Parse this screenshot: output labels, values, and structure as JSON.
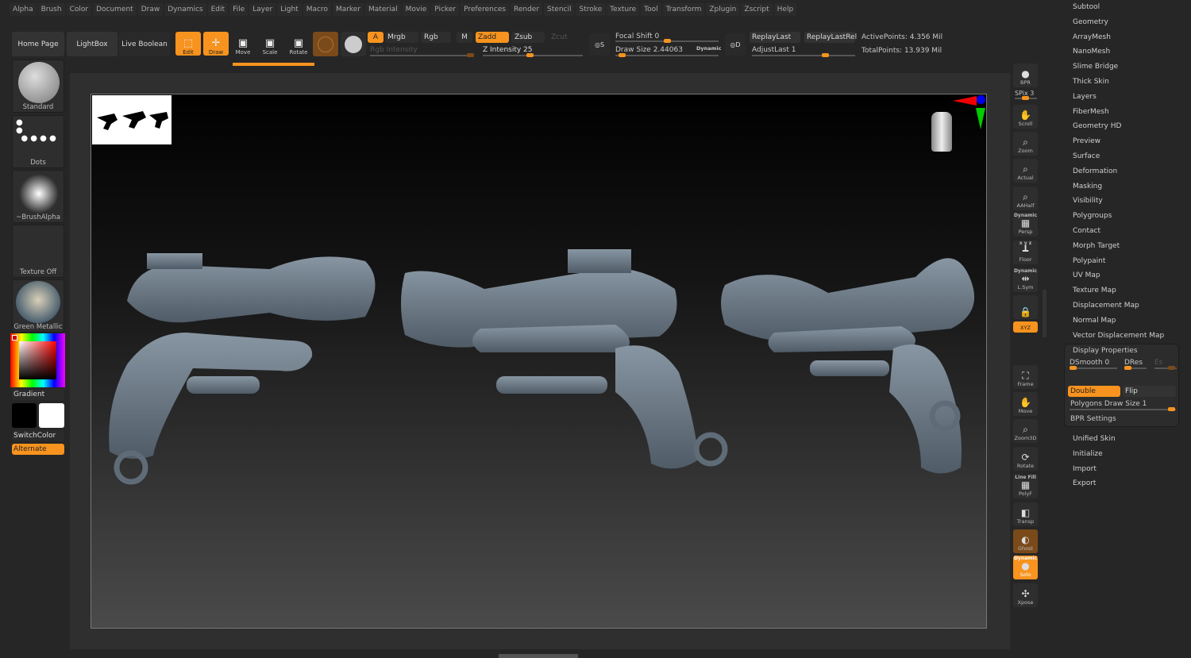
{
  "menu": [
    "Alpha",
    "Brush",
    "Color",
    "Document",
    "Draw",
    "Dynamics",
    "Edit",
    "File",
    "Layer",
    "Light",
    "Macro",
    "Marker",
    "Material",
    "Movie",
    "Picker",
    "Preferences",
    "Render",
    "Stencil",
    "Stroke",
    "Texture",
    "Tool",
    "Transform",
    "Zplugin",
    "Zscript",
    "Help"
  ],
  "toolbar": {
    "home": "Home Page",
    "lightbox": "LightBox",
    "live_boolean": "Live Boolean",
    "edit": "Edit",
    "draw": "Draw",
    "move": "Move",
    "scale": "Scale",
    "rotate": "Rotate",
    "a": "A",
    "mrgb": "Mrgb",
    "rgb": "Rgb",
    "m": "M",
    "zadd": "Zadd",
    "zsub": "Zsub",
    "zcut": "Zcut",
    "rgb_intensity": "Rgb Intensity",
    "z_intensity": "Z Intensity 25",
    "focal_shift": "Focal Shift 0",
    "draw_size": "Draw Size 2.44063",
    "dynamic": "Dynamic",
    "s": "S",
    "d": "D",
    "replay_last": "ReplayLast",
    "replay_last_rel": "ReplayLastRel",
    "adjust_last": "AdjustLast 1",
    "active_points": "ActivePoints: 4.356 Mil",
    "total_points": "TotalPoints: 13.939 Mil",
    "z_intensity_value": 25,
    "draw_size_value": 2.44063,
    "focal_shift_value": 0
  },
  "left": {
    "brush": "Standard",
    "stroke": "Dots",
    "alpha": "~BrushAlpha",
    "texture": "Texture Off",
    "material": "Green Metallic",
    "gradient": "Gradient",
    "switch_color": "SwitchColor",
    "alternate": "Alternate"
  },
  "shelf": [
    {
      "label": "BPR",
      "icon": "sphere-icon"
    },
    {
      "label": "Scroll",
      "icon": "hand-icon"
    },
    {
      "label": "Zoom",
      "icon": "magnifier-icon"
    },
    {
      "label": "Actual",
      "icon": "magnifier-icon"
    },
    {
      "label": "AAHalf",
      "icon": "magnifier-icon"
    },
    {
      "label": "Persp",
      "icon": "grid-icon",
      "top": "Dynamic"
    },
    {
      "label": "Floor",
      "icon": "floor-icon",
      "top": "x y z"
    },
    {
      "label": "L.Sym",
      "icon": "sym-icon",
      "top": "Dynamic"
    },
    {
      "label": "",
      "icon": "camera-lock-icon"
    },
    {
      "label": "XYZ",
      "icon": "rotate-icon"
    },
    {
      "label": "Frame",
      "icon": "frame-icon"
    },
    {
      "label": "Move",
      "icon": "hand-icon"
    },
    {
      "label": "Zoom3D",
      "icon": "magnifier-icon"
    },
    {
      "label": "Rotate",
      "icon": "rotate-icon"
    },
    {
      "label": "PolyF",
      "icon": "grid-icon",
      "top": "Line Fill"
    },
    {
      "label": "Transp",
      "icon": "transp-icon"
    },
    {
      "label": "Ghost",
      "icon": "ghost-icon"
    },
    {
      "label": "Solo",
      "icon": "solo-icon",
      "top": "Dynamic"
    },
    {
      "label": "Xpose",
      "icon": "xpose-icon"
    }
  ],
  "spix": "SPix 3",
  "right": {
    "items_top": [
      "Subtool",
      "Geometry",
      "ArrayMesh",
      "NanoMesh",
      "Slime Bridge",
      "Thick Skin",
      "Layers",
      "FiberMesh",
      "Geometry HD",
      "Preview",
      "Surface",
      "Deformation",
      "Masking",
      "Visibility",
      "Polygroups",
      "Contact",
      "Morph Target",
      "Polypaint",
      "UV Map",
      "Texture Map",
      "Displacement Map",
      "Normal Map",
      "Vector Displacement Map"
    ],
    "display_properties": {
      "title": "Display Properties",
      "dsmooth": "DSmooth 0",
      "dres": "DRes",
      "es": "Es",
      "double": "Double",
      "flip": "Flip",
      "poly_draw_size": "Polygons Draw Size 1",
      "bpr_settings": "BPR Settings"
    },
    "items_bottom": [
      "Unified Skin",
      "Initialize",
      "Import",
      "Export"
    ]
  },
  "colors": {
    "accent": "#f7931e",
    "mesh": "#6e7c89"
  }
}
